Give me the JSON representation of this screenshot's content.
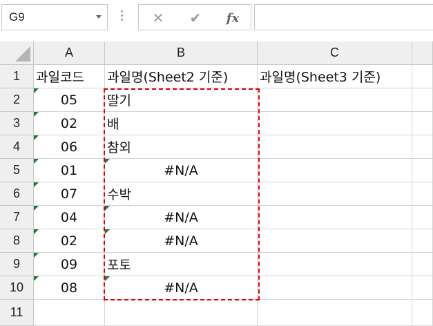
{
  "name_box": {
    "value": "G9"
  },
  "formula_bar": {
    "cancel_glyph": "✕",
    "enter_glyph": "✔",
    "function_label": "fx",
    "value": ""
  },
  "columns": [
    "A",
    "B",
    "C"
  ],
  "row_numbers": [
    "1",
    "2",
    "3",
    "4",
    "5",
    "6",
    "7",
    "8",
    "9",
    "10",
    "11"
  ],
  "header_row": {
    "a": "과일코드",
    "b": "과일명(Sheet2 기준)",
    "c": "과일명(Sheet3 기준)"
  },
  "rows": [
    {
      "a": "05",
      "b": "딸기",
      "b_error": false,
      "c": ""
    },
    {
      "a": "02",
      "b": "배",
      "b_error": false,
      "c": ""
    },
    {
      "a": "06",
      "b": "참외",
      "b_error": false,
      "c": ""
    },
    {
      "a": "01",
      "b": "#N/A",
      "b_error": true,
      "c": ""
    },
    {
      "a": "07",
      "b": "수박",
      "b_error": false,
      "c": ""
    },
    {
      "a": "04",
      "b": "#N/A",
      "b_error": true,
      "c": ""
    },
    {
      "a": "02",
      "b": "#N/A",
      "b_error": true,
      "c": ""
    },
    {
      "a": "09",
      "b": "포토",
      "b_error": false,
      "c": ""
    },
    {
      "a": "08",
      "b": "#N/A",
      "b_error": true,
      "c": ""
    }
  ],
  "colors": {
    "selection_dash": "#e00000",
    "error_indicator": "#1e7a32"
  }
}
